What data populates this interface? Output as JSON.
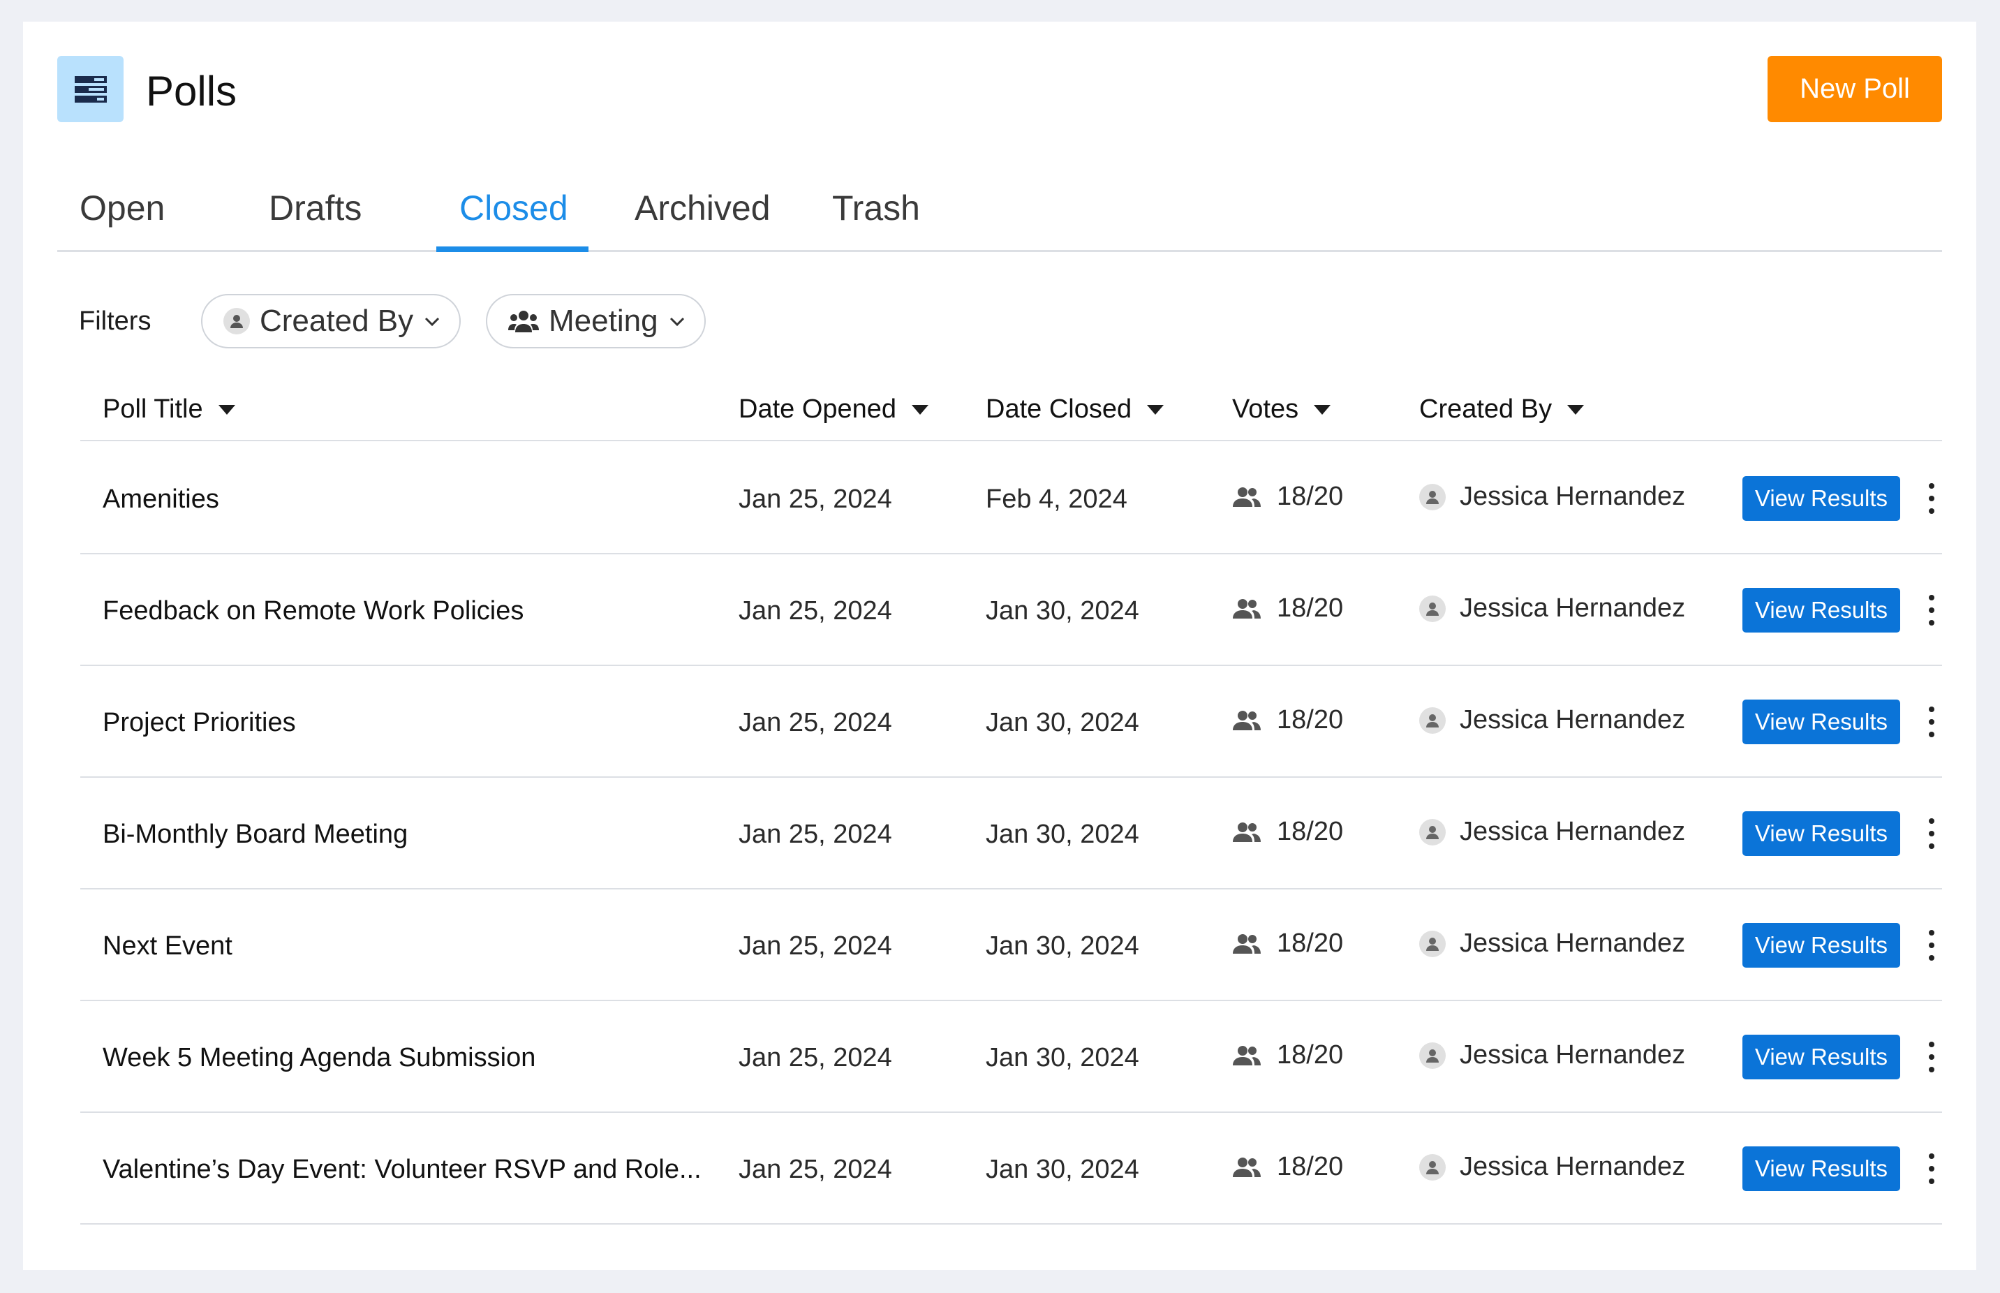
{
  "header": {
    "title": "Polls",
    "new_poll_label": "New Poll"
  },
  "tabs": [
    {
      "label": "Open",
      "active": false
    },
    {
      "label": "Drafts",
      "active": false
    },
    {
      "label": "Closed",
      "active": true
    },
    {
      "label": "Archived",
      "active": false
    },
    {
      "label": "Trash",
      "active": false
    }
  ],
  "filters": {
    "label": "Filters",
    "created_by_label": "Created By",
    "meeting_label": "Meeting"
  },
  "table": {
    "columns": [
      "Poll Title",
      "Date Opened",
      "Date Closed",
      "Votes",
      "Created By"
    ],
    "view_results_label": "View Results",
    "rows": [
      {
        "title": "Amenities",
        "opened": "Jan 25, 2024",
        "closed": "Feb 4, 2024",
        "votes": "18/20",
        "creator": "Jessica Hernandez"
      },
      {
        "title": "Feedback on Remote Work Policies",
        "opened": "Jan 25, 2024",
        "closed": "Jan 30, 2024",
        "votes": "18/20",
        "creator": "Jessica Hernandez"
      },
      {
        "title": "Project Priorities",
        "opened": "Jan 25, 2024",
        "closed": "Jan 30, 2024",
        "votes": "18/20",
        "creator": "Jessica Hernandez"
      },
      {
        "title": "Bi-Monthly Board Meeting",
        "opened": "Jan 25, 2024",
        "closed": "Jan 30, 2024",
        "votes": "18/20",
        "creator": "Jessica Hernandez"
      },
      {
        "title": "Next Event",
        "opened": "Jan 25, 2024",
        "closed": "Jan 30, 2024",
        "votes": "18/20",
        "creator": "Jessica Hernandez"
      },
      {
        "title": "Week 5 Meeting Agenda Submission",
        "opened": "Jan 25, 2024",
        "closed": "Jan 30, 2024",
        "votes": "18/20",
        "creator": "Jessica Hernandez"
      },
      {
        "title": "Valentine’s Day Event: Volunteer RSVP and Role...",
        "opened": "Jan 25, 2024",
        "closed": "Jan 30, 2024",
        "votes": "18/20",
        "creator": "Jessica Hernandez"
      }
    ]
  },
  "colors": {
    "accent": "#1c8de8",
    "primary_button": "#ff8a00",
    "view_button": "#0b74d8",
    "icon_bg": "#b9e1fd"
  },
  "icons": {
    "app": "polls-list-icon",
    "person": "person-icon",
    "group": "group-icon",
    "chevron": "chevron-down-icon",
    "sort": "sort-caret-icon",
    "more": "more-vertical-icon"
  }
}
